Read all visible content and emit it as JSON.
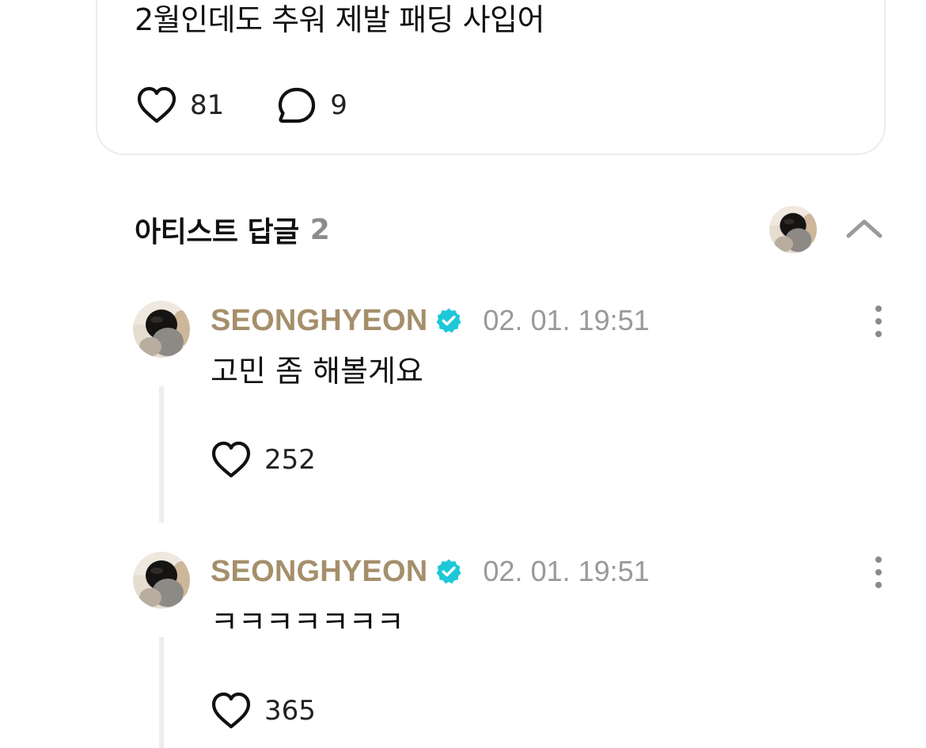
{
  "post": {
    "text": "2월인데도 추워 제발 패딩 사입어",
    "likes": "81",
    "comments": "9"
  },
  "artist_replies": {
    "title": "아티스트 답글",
    "count": "2",
    "replies": [
      {
        "author": "SEONGHYEON",
        "timestamp": "02. 01. 19:51",
        "text": "고민 좀 해볼게요",
        "likes": "252"
      },
      {
        "author": "SEONGHYEON",
        "timestamp": "02. 01. 19:51",
        "text": "ㅋㅋㅋㅋㅋㅋㅋ",
        "likes": "365"
      }
    ]
  },
  "icons": {
    "like": "heart-outline-icon",
    "comment": "speech-bubble-icon",
    "verified": "verified-badge-icon",
    "collapse": "chevron-up-icon",
    "more": "more-vertical-icon"
  },
  "colors": {
    "author_name": "#a58f6b",
    "verified_badge": "#1ec8d8",
    "timestamp": "#999999",
    "reply_count": "#8c8c8c",
    "card_border": "#ececec",
    "thread_line": "#ededed"
  }
}
